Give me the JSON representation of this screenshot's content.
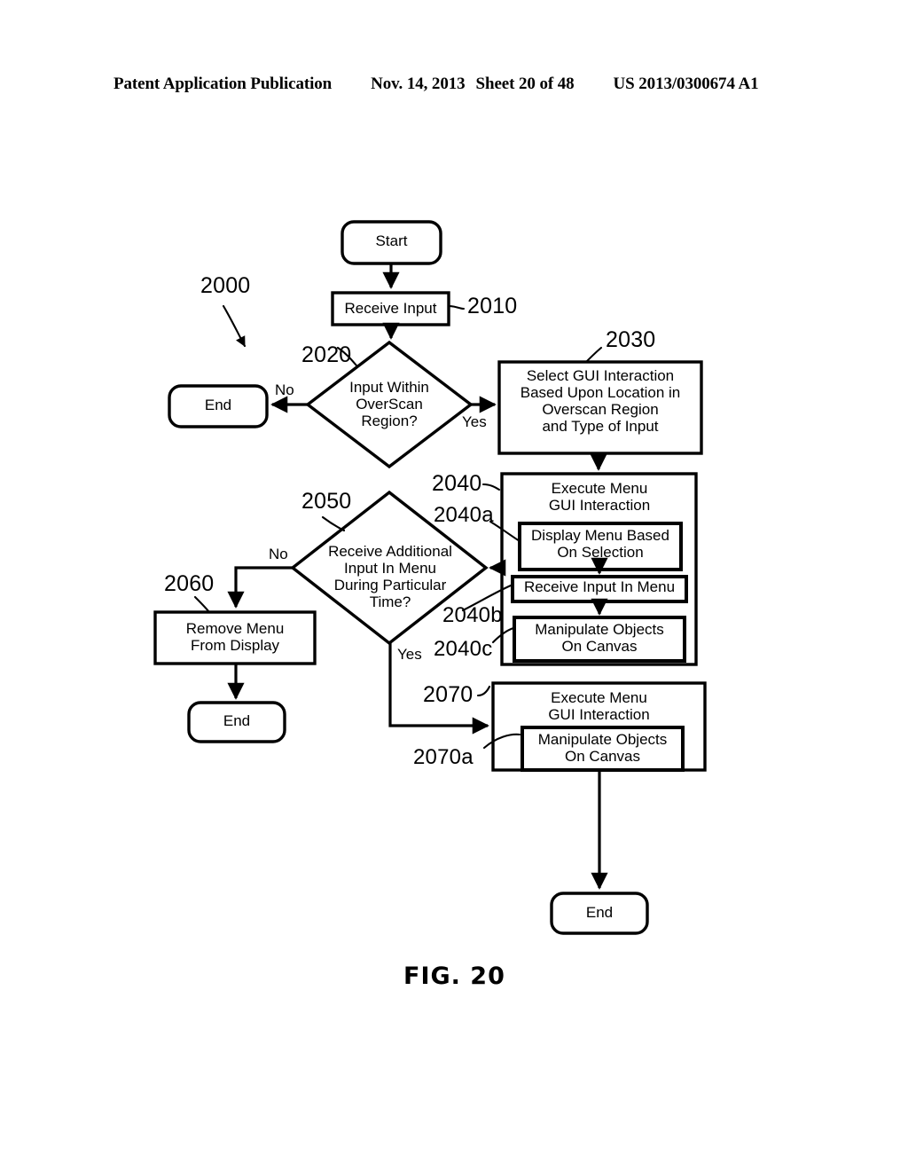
{
  "header": {
    "title": "Patent Application Publication",
    "date": "Nov. 14, 2013",
    "sheet": "Sheet 20 of 48",
    "number": "US 2013/0300674 A1"
  },
  "figure": {
    "caption": "FIG. 20",
    "nodes": {
      "start": "Start",
      "receive_input": "Receive Input",
      "decision_overscan": "Input Within\nOverScan\nRegion?",
      "end_no": "End",
      "select_gui": "Select GUI Interaction\nBased Upon Location in\nOverscan Region\nand Type of Input",
      "execute_menu_2040_head": "Execute Menu\nGUI Interaction",
      "display_menu": "Display Menu Based\nOn Selection",
      "receive_input_in_menu": "Receive Input In Menu",
      "manipulate_objects_2040": "Manipulate Objects\nOn Canvas",
      "decision_additional": "Receive Additional\nInput In Menu\nDuring Particular\nTime?",
      "remove_menu": "Remove Menu\nFrom Display",
      "end_remove": "End",
      "execute_menu_2070_head": "Execute Menu\nGUI Interaction",
      "manipulate_objects_2070": "Manipulate Objects\nOn Canvas",
      "end_final": "End"
    },
    "edge_labels": {
      "overscan_no": "No",
      "overscan_yes": "Yes",
      "additional_no": "No",
      "additional_yes": "Yes"
    },
    "reference_numerals": {
      "flow": "2000",
      "receive_input": "2010",
      "decision_overscan": "2020",
      "select_gui": "2030",
      "execute_menu": "2040",
      "display_menu": "2040a",
      "receive_input_in_menu": "2040b",
      "manipulate_objects": "2040c",
      "decision_additional": "2050",
      "remove_menu": "2060",
      "execute_menu_2070": "2070",
      "manipulate_objects_2070a": "2070a"
    }
  }
}
